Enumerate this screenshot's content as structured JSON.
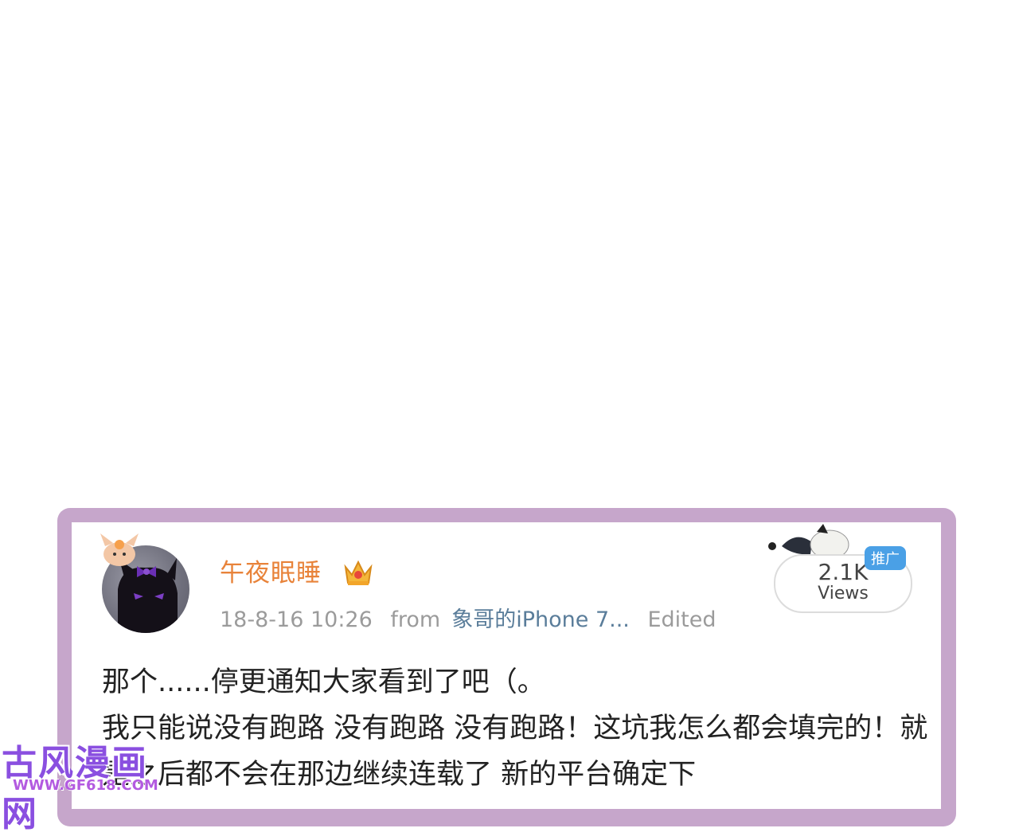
{
  "post": {
    "username": "午夜眠睡",
    "timestamp": "18-8-16 10:26",
    "from_label": "from",
    "device": "象哥的iPhone 7...",
    "edited_label": "Edited",
    "views_count": "2.1K",
    "views_label": "Views",
    "promo_badge": "推广",
    "body": "那个......停更通知大家看到了吧（。\n我只能说没有跑路 没有跑路 没有跑路！这坑我怎么都会填完的！就是之后都不会在那边继续连载了 新的平台确定下"
  },
  "watermark": {
    "title": "古风漫画网",
    "url": "WWW.GF618.COM"
  },
  "colors": {
    "frame": "#c6a6cb",
    "username": "#e8833a",
    "device_link": "#5a7d9a",
    "badge": "#4aa0e6"
  },
  "icons": {
    "crown": "crown-icon",
    "avatar": "cat-avatar"
  }
}
